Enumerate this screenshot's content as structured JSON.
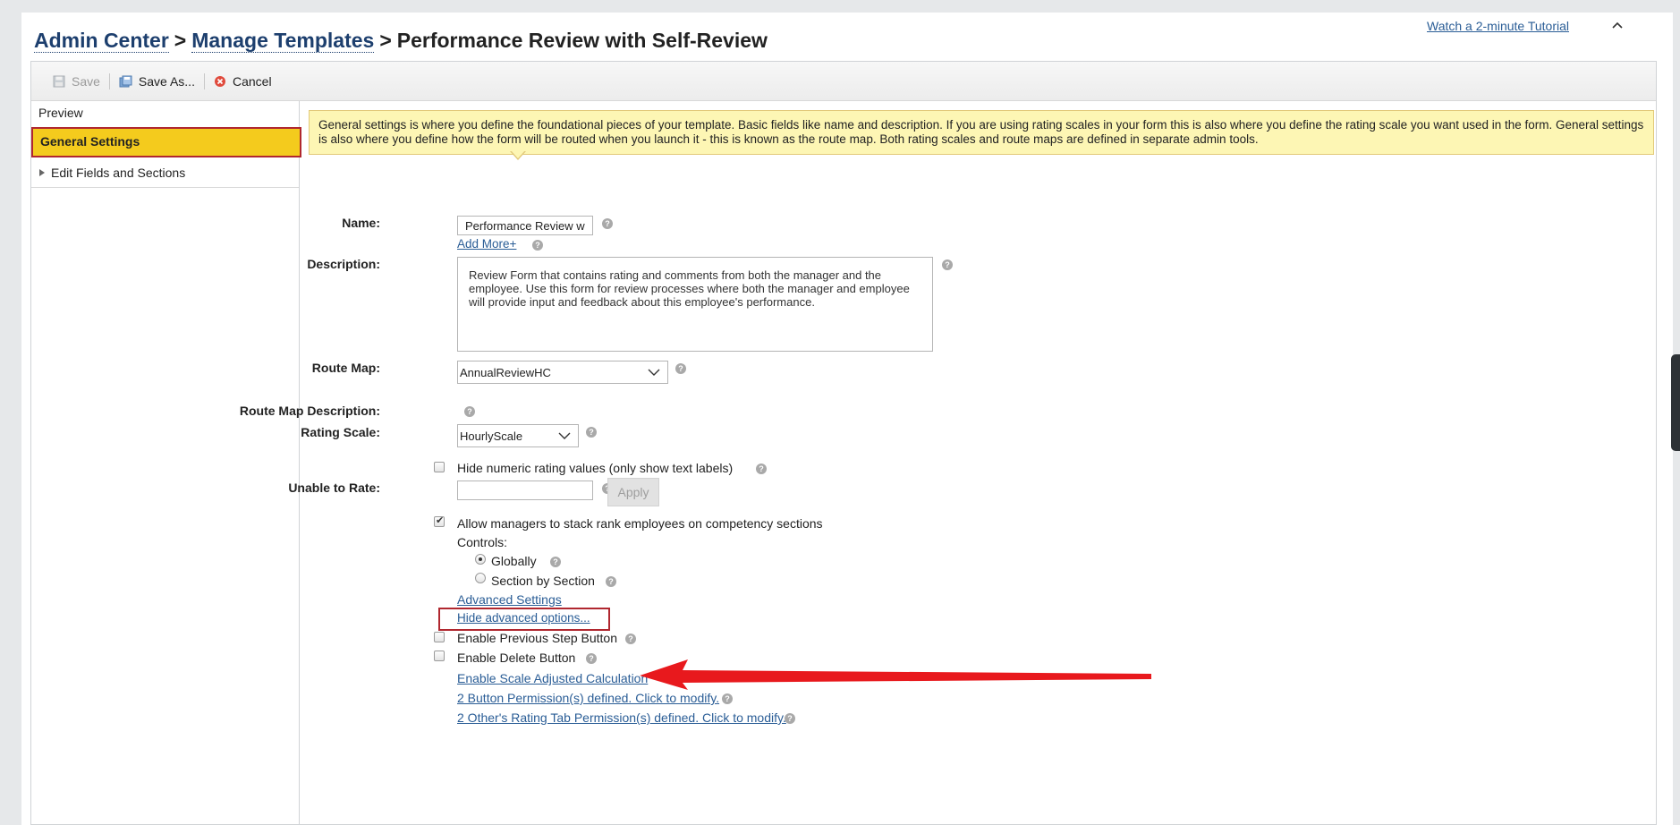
{
  "header": {
    "tutorial_link": "Watch a 2-minute Tutorial",
    "breadcrumb": {
      "crumb1": "Admin Center",
      "crumb2": "Manage Templates",
      "separator": ">",
      "current": "Performance Review with Self-Review"
    }
  },
  "toolbar": {
    "save_label": "Save",
    "save_as_label": "Save As...",
    "cancel_label": "Cancel"
  },
  "sidebar": {
    "items": [
      {
        "label": "Preview"
      },
      {
        "label": "General Settings"
      },
      {
        "label": "Edit Fields and Sections"
      }
    ]
  },
  "info": {
    "text": "General settings is where you define the foundational pieces of your template. Basic fields like name and description. If you are using rating scales in your form this is also where you define the rating scale you want used in the form. General settings is also where you define how the form will be routed when you launch it - this is known as the route map. Both rating scales and route maps are defined in separate admin tools."
  },
  "form": {
    "name_label": "Name:",
    "name_value": "Performance Review wit",
    "add_more": "Add More+",
    "description_label": "Description:",
    "description_value": "Review Form that contains rating and comments from both the manager and the employee. Use this form for review processes where both the manager and employee will provide input and feedback about this employee's performance.",
    "route_map_label": "Route Map:",
    "route_map_value": "AnnualReviewHC",
    "route_map_desc_label": "Route Map Description:",
    "rating_scale_label": "Rating Scale:",
    "rating_scale_value": "HourlyScale",
    "hide_numeric": "Hide numeric rating values (only show text labels)",
    "unable_to_rate_label": "Unable to Rate:",
    "unable_to_rate_value": "",
    "apply_label": "Apply",
    "stack_rank": "Allow managers to stack rank employees on competency sections",
    "controls_label": "Controls:",
    "globally": "Globally",
    "section_by_section": "Section by Section",
    "advanced_settings": "Advanced Settings",
    "hide_advanced": "Hide advanced options...",
    "enable_prev_step": "Enable Previous Step Button",
    "enable_delete": "Enable Delete Button",
    "enable_scale_adjusted": "Enable Scale Adjusted Calculation",
    "button_permissions": "2 Button Permission(s) defined. Click to modify.",
    "rating_tab_permissions": "2 Other's Rating Tab Permission(s) defined. Click to modify."
  },
  "colors": {
    "active_item": "#f4cb1d",
    "highlight_border": "#b0272f",
    "link": "#2a5d96",
    "info_bg": "#fdf6b4",
    "arrow": "#e8191d"
  }
}
